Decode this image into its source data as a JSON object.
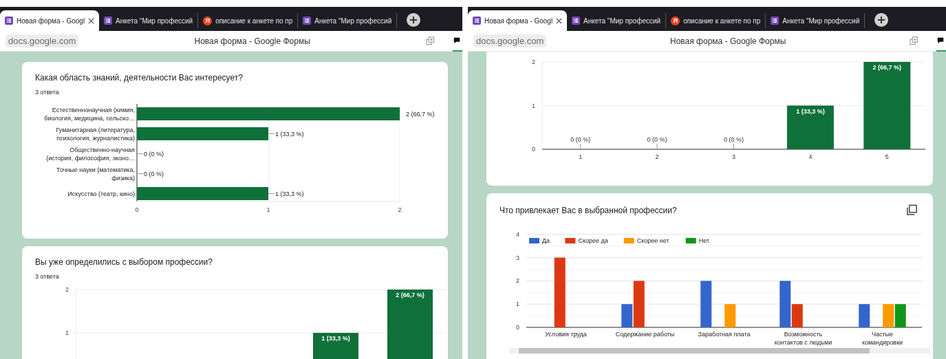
{
  "windows": [
    {
      "tabs": [
        {
          "title": "Новая форма - Googl",
          "kind": "forms",
          "selected": true
        },
        {
          "title": "Анкета \"Мир профессий",
          "kind": "forms",
          "selected": false
        },
        {
          "title": "описание к анкете по пр",
          "kind": "yandex",
          "glyph": "Я",
          "selected": false
        },
        {
          "title": "Анкета \"Мир профессий",
          "kind": "forms",
          "selected": false
        }
      ],
      "address": "docs.google.com",
      "page_title": "Новая форма - Google Формы",
      "cards": [
        {
          "title": "Какая область знаний, деятельности Вас интересует?",
          "responses": "3 ответа",
          "chart_data": {
            "type": "bar",
            "orientation": "horizontal",
            "categories": [
              "Естественнонаучная (химия, биология, медицина, сельско…",
              "Гуманитарная (литература, психология, журналистика)",
              "Общественно-научная (история, философия, эконо…",
              "Точные науки (математика, физика)",
              "Искусство (театр, кино)"
            ],
            "values": [
              2,
              1,
              0,
              0,
              1
            ],
            "value_labels": [
              "2 (66,7 %)",
              "1 (33,3 %)",
              "0 (0 %)",
              "0 (0 %)",
              "1 (33,3 %)"
            ],
            "xlim": [
              0,
              2
            ],
            "xticks": [
              0,
              1,
              2
            ],
            "grid": true
          }
        },
        {
          "title": "Вы уже определились с выбором профессии?",
          "responses": "3 ответа",
          "chart_data": {
            "type": "bar",
            "orientation": "vertical",
            "values": [
              null,
              null,
              null,
              1,
              2
            ],
            "value_labels": [
              null,
              null,
              null,
              "1 (33,3 %)",
              "2 (66,7 %)"
            ],
            "ylim": [
              0,
              2
            ],
            "yticks": [
              1,
              2
            ],
            "grid": true
          }
        }
      ]
    },
    {
      "tabs": [
        {
          "title": "Новая форма - Googl",
          "kind": "forms",
          "selected": true
        },
        {
          "title": "Анкета \"Мир профессий",
          "kind": "forms",
          "selected": false
        },
        {
          "title": "описание к анкете по пр",
          "kind": "yandex",
          "glyph": "Я",
          "selected": false
        },
        {
          "title": "Анкета \"Мир профессий",
          "kind": "forms",
          "selected": false
        }
      ],
      "address": "docs.google.com",
      "page_title": "Новая форма - Google Формы",
      "cards": [
        {
          "chart_data": {
            "type": "bar",
            "orientation": "vertical",
            "categories": [
              "1",
              "2",
              "3",
              "4",
              "5"
            ],
            "values": [
              0,
              0,
              0,
              1,
              2
            ],
            "value_labels": [
              "0 (0 %)",
              "0 (0 %)",
              "0 (0 %)",
              "1 (33,3 %)",
              "2 (66,7 %)"
            ],
            "ylim": [
              0,
              2
            ],
            "yticks": [
              0,
              1,
              2
            ],
            "grid": true
          }
        },
        {
          "title": "Что привлекает Вас в выбранной профессии?",
          "copy_icon": true,
          "chart_data": {
            "type": "bar",
            "orientation": "vertical",
            "categories": [
              "Условия труда",
              "Содержание работы",
              "Заработная плата",
              "Возможность контактов с людьми",
              "Частые командировки"
            ],
            "series": [
              {
                "name": "Да",
                "color": "#3366cc",
                "values": [
                  0,
                  1,
                  2,
                  2,
                  1
                ]
              },
              {
                "name": "Скорее да",
                "color": "#dc3912",
                "values": [
                  3,
                  2,
                  0,
                  1,
                  0
                ]
              },
              {
                "name": "Скорее нет",
                "color": "#ff9900",
                "values": [
                  0,
                  0,
                  1,
                  0,
                  1
                ]
              },
              {
                "name": "Нет",
                "color": "#109618",
                "values": [
                  0,
                  0,
                  0,
                  0,
                  1
                ]
              }
            ],
            "ylim": [
              0,
              4
            ],
            "yticks": [
              0,
              1,
              2,
              3,
              4
            ],
            "grid": true,
            "legend": true
          }
        }
      ]
    }
  ]
}
